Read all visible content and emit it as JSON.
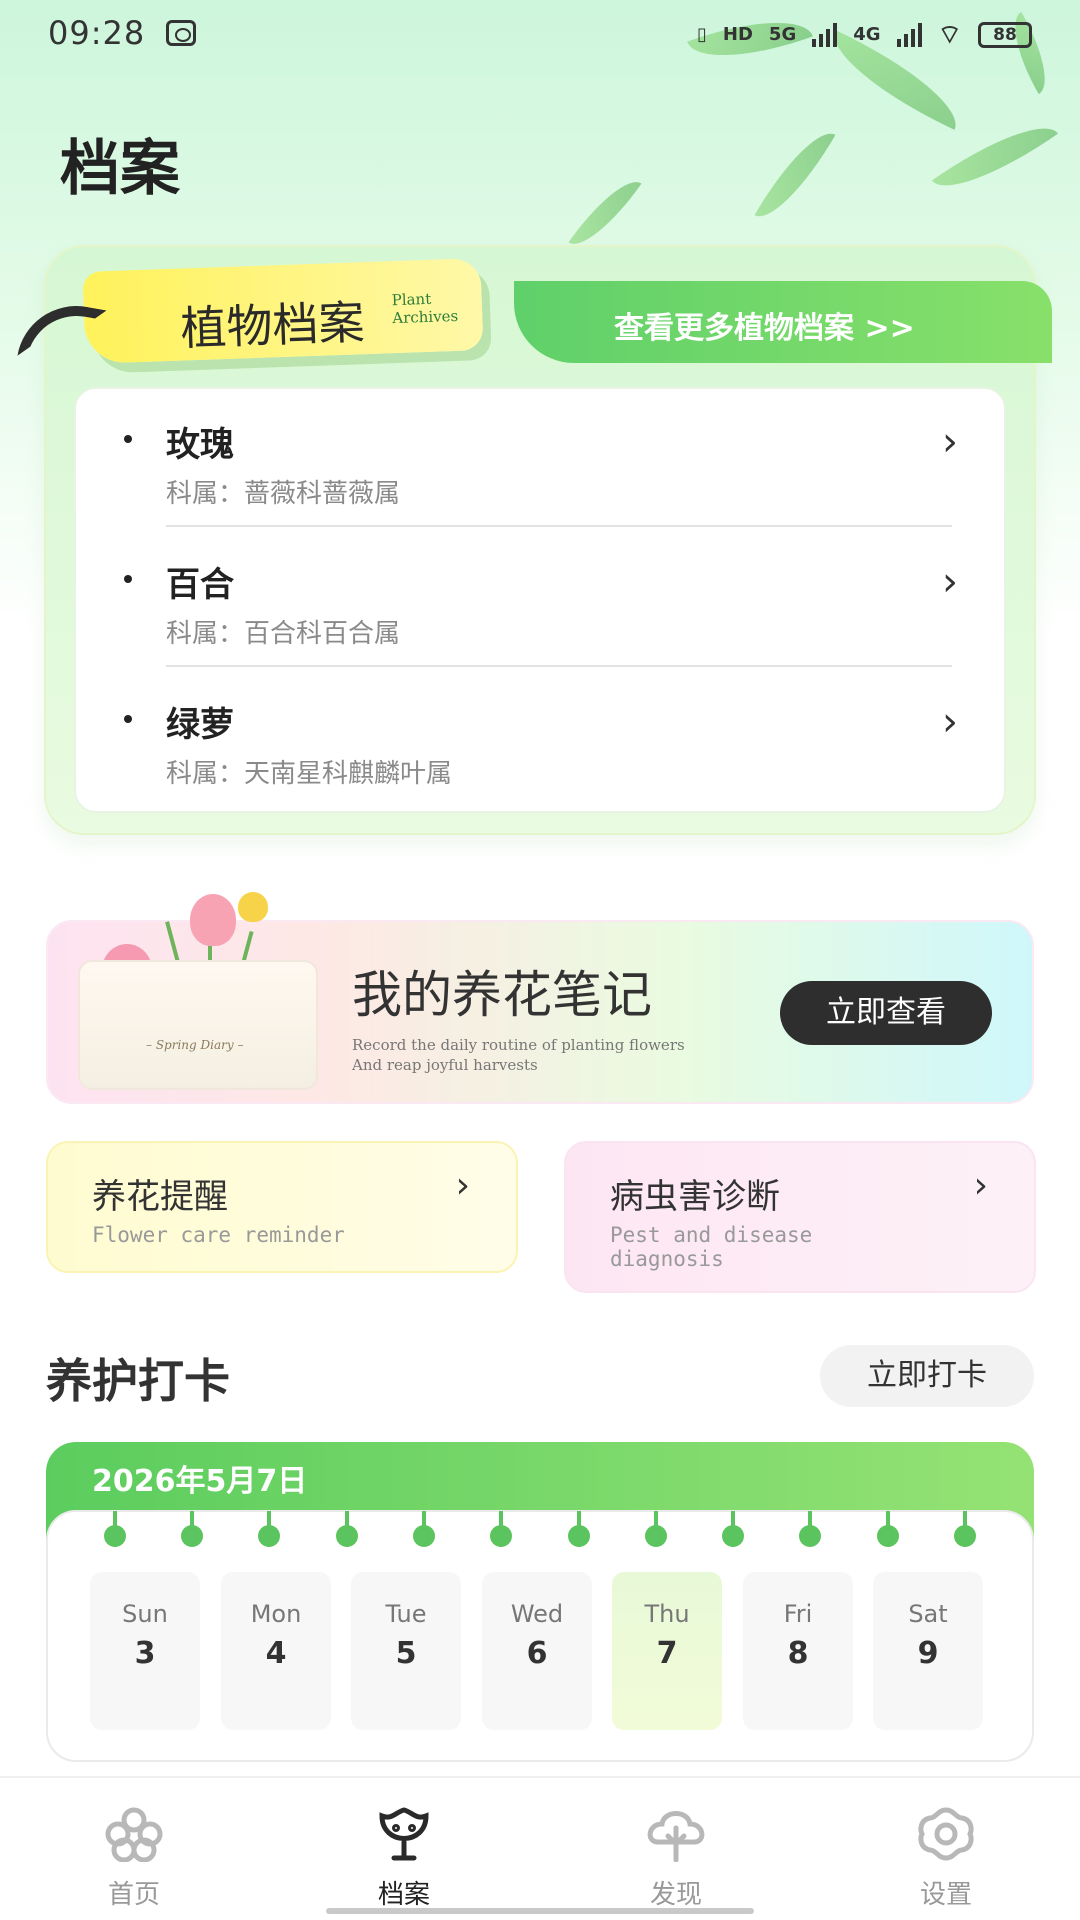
{
  "status_bar": {
    "time": "09:28",
    "battery": "88",
    "net1": "HD",
    "net2": "5G",
    "net3": "4G"
  },
  "page_title": "档案",
  "plant_archives": {
    "tag_title": "植物档案",
    "tag_en_line1": "Plant",
    "tag_en_line2": "Archives",
    "more_link": "查看更多植物档案 >>",
    "items": [
      {
        "name": "玫瑰",
        "family": "科属：蔷薇科蔷薇属"
      },
      {
        "name": "百合",
        "family": "科属：百合科百合属"
      },
      {
        "name": "绿萝",
        "family": "科属：天南星科麒麟叶属"
      }
    ]
  },
  "notes_banner": {
    "title": "我的养花笔记",
    "subtitle_line1": "Record the daily routine of planting flowers",
    "subtitle_line2": "And reap joyful harvests",
    "envelope_label": "– Spring Diary –",
    "button": "立即查看"
  },
  "cards": {
    "reminder": {
      "title": "养花提醒",
      "subtitle": "Flower care reminder"
    },
    "pest": {
      "title": "病虫害诊断",
      "subtitle": "Pest and disease diagnosis"
    }
  },
  "care": {
    "title": "养护打卡",
    "button": "立即打卡",
    "date": "2026年5月7日",
    "days": [
      {
        "weekday": "Sun",
        "num": "3"
      },
      {
        "weekday": "Mon",
        "num": "4"
      },
      {
        "weekday": "Tue",
        "num": "5"
      },
      {
        "weekday": "Wed",
        "num": "6"
      },
      {
        "weekday": "Thu",
        "num": "7"
      },
      {
        "weekday": "Fri",
        "num": "8"
      },
      {
        "weekday": "Sat",
        "num": "9"
      }
    ],
    "active_day": "Thu"
  },
  "nav": {
    "items": [
      {
        "label": "首页",
        "icon": "flower-icon"
      },
      {
        "label": "档案",
        "icon": "plant-face-icon"
      },
      {
        "label": "发现",
        "icon": "tree-icon"
      },
      {
        "label": "设置",
        "icon": "settings-flower-icon"
      }
    ],
    "active": "档案"
  },
  "colors": {
    "accent_green": "#5bcd5e",
    "tag_yellow": "#fff25a",
    "button_dark": "#2e2e2e"
  }
}
